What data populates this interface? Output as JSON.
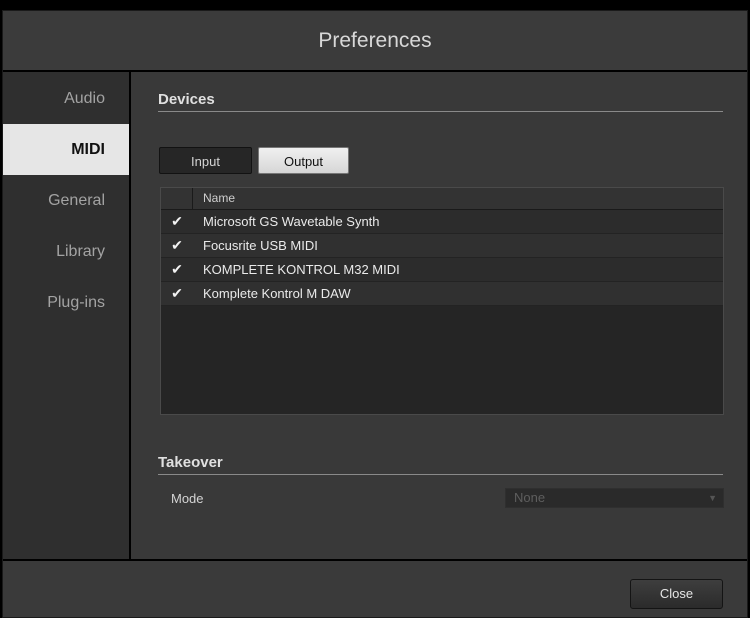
{
  "window": {
    "title": "Preferences"
  },
  "sidebar": {
    "items": [
      {
        "label": "Audio",
        "active": false
      },
      {
        "label": "MIDI",
        "active": true
      },
      {
        "label": "General",
        "active": false
      },
      {
        "label": "Library",
        "active": false
      },
      {
        "label": "Plug-ins",
        "active": false
      }
    ]
  },
  "devices": {
    "heading": "Devices",
    "tabs": {
      "input_label": "Input",
      "output_label": "Output",
      "selected": "Output"
    },
    "table": {
      "column_name": "Name",
      "rows": [
        {
          "checked": true,
          "check_glyph": "✔",
          "name": "Microsoft GS Wavetable Synth"
        },
        {
          "checked": true,
          "check_glyph": "✔",
          "name": "Focusrite USB MIDI"
        },
        {
          "checked": true,
          "check_glyph": "✔",
          "name": "KOMPLETE KONTROL M32 MIDI"
        },
        {
          "checked": true,
          "check_glyph": "✔",
          "name": "Komplete Kontrol M DAW"
        }
      ]
    }
  },
  "takeover": {
    "heading": "Takeover",
    "mode_label": "Mode",
    "mode_value": "None",
    "mode_disabled": true
  },
  "footer": {
    "close_label": "Close"
  },
  "icons": {
    "checkmark": "checkmark-icon",
    "dropdown_arrow": "chevron-down-icon"
  },
  "colors": {
    "background": "#393939",
    "sidebar_active": "#e6e6e6",
    "text_primary": "#e0e0e0"
  }
}
